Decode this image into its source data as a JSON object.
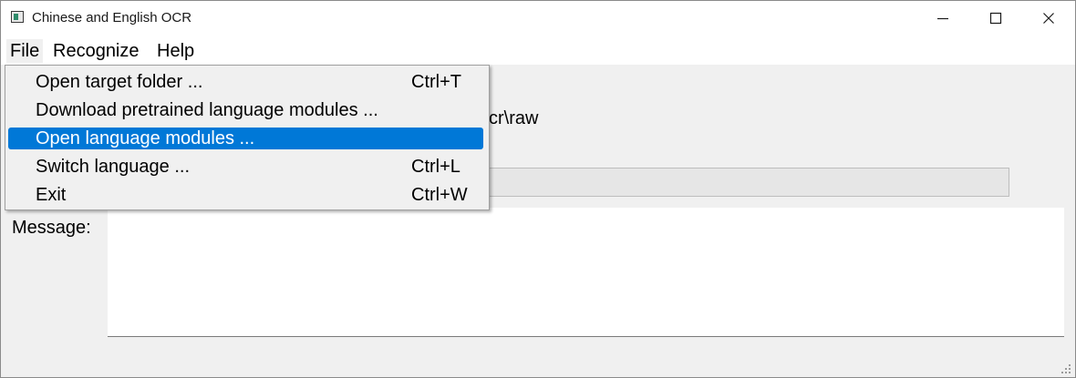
{
  "window": {
    "title": "Chinese and English OCR"
  },
  "menubar": {
    "items": [
      {
        "label": "File"
      },
      {
        "label": "Recognize"
      },
      {
        "label": "Help"
      }
    ]
  },
  "file_menu": {
    "items": [
      {
        "label": "Open target folder ...",
        "shortcut": "Ctrl+T"
      },
      {
        "label": "Download pretrained language modules ...",
        "shortcut": ""
      },
      {
        "label": "Open language modules ...",
        "shortcut": ""
      },
      {
        "label": "Switch language ...",
        "shortcut": "Ctrl+L"
      },
      {
        "label": "Exit",
        "shortcut": "Ctrl+W"
      }
    ],
    "highlighted_index": 2,
    "highlight_color": "#0078d7"
  },
  "main": {
    "path_text": "cr\\raw",
    "message_label": "Message:",
    "message_text": ""
  },
  "icons": {
    "app": "app-window-icon",
    "minimize": "minimize-icon",
    "maximize": "maximize-icon",
    "close": "close-icon",
    "grip": "resize-grip-icon"
  }
}
